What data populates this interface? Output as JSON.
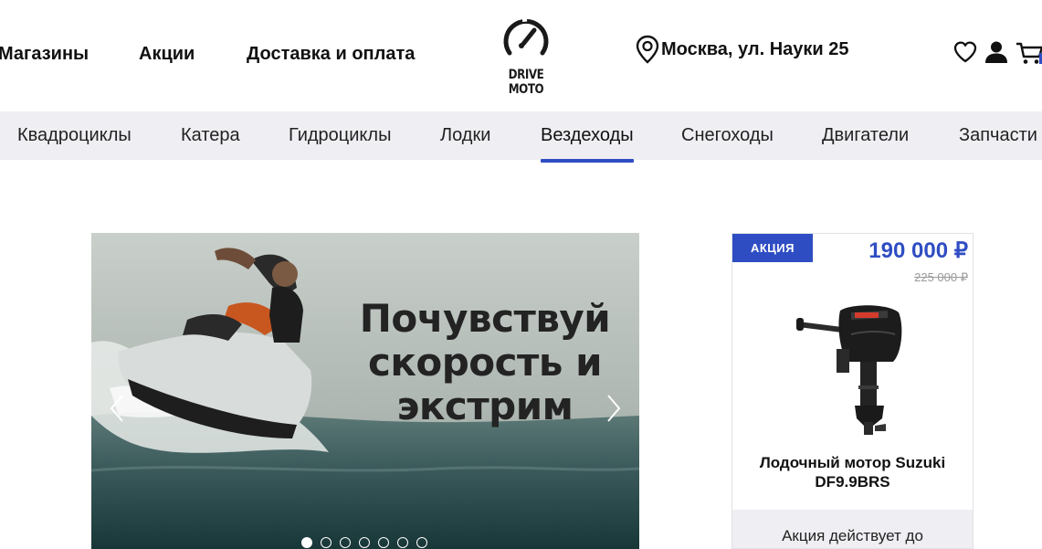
{
  "header": {
    "nav": [
      {
        "label": "Магазины"
      },
      {
        "label": "Акции"
      },
      {
        "label": "Доставка и оплата"
      }
    ],
    "logo_text": "DRIVE MOTO",
    "location": "Москва, ул. Науки 25",
    "icons": [
      "location-pin-icon",
      "heart-icon",
      "user-icon",
      "cart-icon"
    ]
  },
  "categories": [
    {
      "label": "Квадроциклы"
    },
    {
      "label": "Катера"
    },
    {
      "label": "Гидроциклы"
    },
    {
      "label": "Лодки"
    },
    {
      "label": "Вездеходы",
      "active": true
    },
    {
      "label": "Снегоходы"
    },
    {
      "label": "Двигатели"
    },
    {
      "label": "Запчасти"
    }
  ],
  "banner": {
    "lines": [
      "Почувствуй",
      "скорость и",
      "экстрим"
    ],
    "slide_count": 7,
    "active_slide": 1
  },
  "promo": {
    "badge": "АКЦИЯ",
    "price": "190 000 ₽",
    "old_price": "225 000 ₽",
    "title": "Лодочный мотор Suzuki DF9.9BRS",
    "footer": "Акция действует до"
  },
  "colors": {
    "accent": "#2f4dc3",
    "catbar_bg": "#efeff3",
    "text": "#111111",
    "old_price": "#9a9a9a"
  }
}
